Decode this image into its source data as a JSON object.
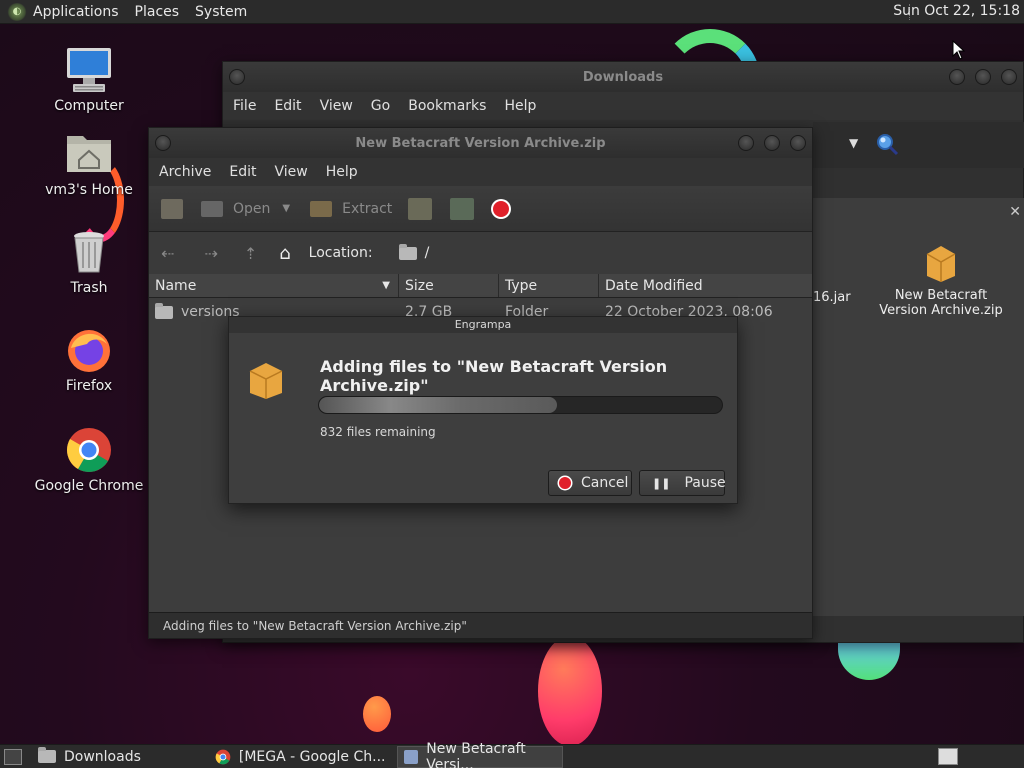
{
  "top_panel": {
    "menus": [
      "Applications",
      "Places",
      "System"
    ],
    "clock": "Sun Oct 22, 15:18"
  },
  "desktop": {
    "icons": [
      {
        "label": "Computer",
        "icon": "computer-icon"
      },
      {
        "label": "vm3's Home",
        "icon": "home-folder-icon"
      },
      {
        "label": "Trash",
        "icon": "trash-icon"
      },
      {
        "label": "Firefox",
        "icon": "firefox-icon"
      },
      {
        "label": "Google Chrome",
        "icon": "chrome-icon"
      }
    ]
  },
  "downloads_window": {
    "title": "Downloads",
    "menus": [
      "File",
      "Edit",
      "View",
      "Go",
      "Bookmarks",
      "Help"
    ],
    "files": [
      {
        "name": "16.jar"
      },
      {
        "name": "New Betacraft Version Archive.zip"
      }
    ]
  },
  "archive_window": {
    "title": "New Betacraft Version Archive.zip",
    "menus": [
      "Archive",
      "Edit",
      "View",
      "Help"
    ],
    "toolbar": {
      "open_label": "Open",
      "extract_label": "Extract"
    },
    "location_label": "Location:",
    "location_value": "/",
    "columns": [
      "Name",
      "Size",
      "Type",
      "Date Modified"
    ],
    "rows": [
      {
        "name": "versions",
        "size": "2.7 GB",
        "type": "Folder",
        "date": "22 October 2023, 08:06"
      }
    ],
    "status": "Adding files to \"New Betacraft Version Archive.zip\""
  },
  "dialog": {
    "title": "Engrampa",
    "heading": "Adding files to \"New Betacraft Version Archive.zip\"",
    "progress_fraction": 0.59,
    "remaining": "832 files remaining",
    "cancel_label": "Cancel",
    "pause_label": "Pause"
  },
  "taskbar": {
    "items": [
      {
        "label": "Downloads",
        "active": false
      },
      {
        "label": "[MEGA - Google Ch...",
        "active": false
      },
      {
        "label": "New Betacraft Versi...",
        "active": true
      }
    ]
  },
  "colors": {
    "accent_red": "#e0202a",
    "archive_orange": "#e8a640"
  }
}
